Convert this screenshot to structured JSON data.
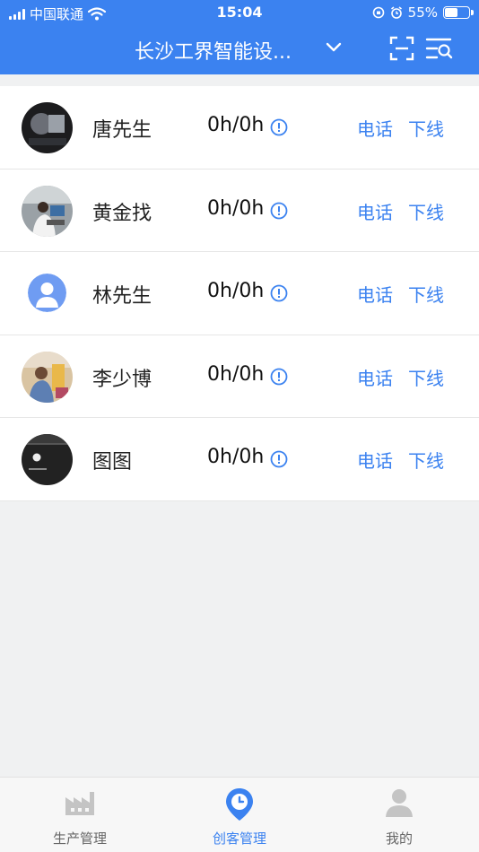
{
  "status_bar": {
    "carrier": "中国联通",
    "time": "15:04",
    "battery": "55%"
  },
  "header": {
    "title": "长沙工界智能设...",
    "icons": [
      "chevron-down-icon",
      "scan-icon",
      "filter-search-icon"
    ]
  },
  "members": [
    {
      "name": "唐先生",
      "hours": "0h/0h",
      "call_label": "电话",
      "offline_label": "下线"
    },
    {
      "name": "黄金找",
      "hours": "0h/0h",
      "call_label": "电话",
      "offline_label": "下线"
    },
    {
      "name": "林先生",
      "hours": "0h/0h",
      "call_label": "电话",
      "offline_label": "下线"
    },
    {
      "name": "李少博",
      "hours": "0h/0h",
      "call_label": "电话",
      "offline_label": "下线"
    },
    {
      "name": "图图",
      "hours": "0h/0h",
      "call_label": "电话",
      "offline_label": "下线"
    }
  ],
  "tabbar": {
    "tabs": [
      {
        "label": "生产管理",
        "icon": "factory-icon",
        "active": false
      },
      {
        "label": "创客管理",
        "icon": "location-clock-icon",
        "active": true
      },
      {
        "label": "我的",
        "icon": "person-icon",
        "active": false
      }
    ]
  },
  "colors": {
    "accent": "#3b82f0",
    "background": "#f0f1f2",
    "inactive_tab": "#b8b8b8"
  }
}
